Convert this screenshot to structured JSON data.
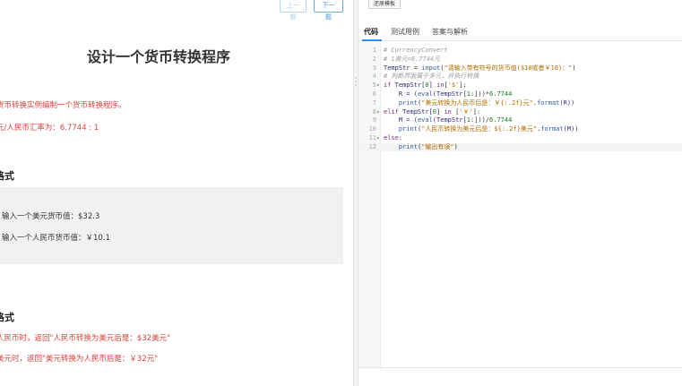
{
  "nav": {
    "prev_label": "上一题",
    "next_label": "下一题"
  },
  "problem": {
    "title": "设计一个货币转换程序",
    "desc_line1": "货币转换实例编制一个货币转换程序。",
    "desc_line2": "元/人民币汇率为：6.7744 : 1",
    "input_heading": "格式",
    "input_sample_1": "输入一个美元货币值：$32.3",
    "input_sample_2": "输入一个人民币货币值：￥10.1",
    "output_heading": "格式",
    "output_line1": "人民币时，返回\"人民币转换为美元后是：$32美元\"",
    "output_line2": "美元时，返回\"美元转换为人民币后是：￥32元\""
  },
  "editor_panel": {
    "restore_label": "还原模板",
    "tabs": [
      "代码",
      "测试用例",
      "答案与解析"
    ],
    "active_tab": "代码",
    "active_line": 12,
    "code_lines": [
      {
        "n": "1",
        "fold": "",
        "parts": [
          {
            "t": "# CurrencyConvert",
            "c": "c-com"
          }
        ]
      },
      {
        "n": "2",
        "fold": "",
        "parts": [
          {
            "t": "# 1美元=6.7744元",
            "c": "c-com"
          }
        ]
      },
      {
        "n": "3",
        "fold": "",
        "parts": [
          {
            "t": "TempStr",
            "c": "c-var"
          },
          {
            "t": " = ",
            "c": "c-p"
          },
          {
            "t": "input",
            "c": "c-fn"
          },
          {
            "t": "(",
            "c": "c-p"
          },
          {
            "t": "\"请输入带有符号的货币值($10或者￥10)：\"",
            "c": "c-str"
          },
          {
            "t": ")",
            "c": "c-p"
          }
        ]
      },
      {
        "n": "4",
        "fold": "",
        "parts": [
          {
            "t": "# 判断界面属于多元，并执行转换",
            "c": "c-com"
          }
        ]
      },
      {
        "n": "5",
        "fold": "▾",
        "parts": [
          {
            "t": "if",
            "c": "c-kw"
          },
          {
            "t": " TempStr[",
            "c": "c-var"
          },
          {
            "t": "0",
            "c": "c-num"
          },
          {
            "t": "] ",
            "c": "c-var"
          },
          {
            "t": "in",
            "c": "c-kw"
          },
          {
            "t": "[",
            "c": "c-p"
          },
          {
            "t": "'$'",
            "c": "c-str"
          },
          {
            "t": "]:",
            "c": "c-p"
          }
        ]
      },
      {
        "n": "6",
        "fold": "",
        "parts": [
          {
            "t": "    R = (",
            "c": "c-var"
          },
          {
            "t": "eval",
            "c": "c-fn"
          },
          {
            "t": "(TempStr[",
            "c": "c-var"
          },
          {
            "t": "1",
            "c": "c-num"
          },
          {
            "t": ":]))*",
            "c": "c-p"
          },
          {
            "t": "6.7744",
            "c": "c-num"
          }
        ]
      },
      {
        "n": "7",
        "fold": "",
        "parts": [
          {
            "t": "    ",
            "c": "c-p"
          },
          {
            "t": "print",
            "c": "c-fn"
          },
          {
            "t": "(",
            "c": "c-p"
          },
          {
            "t": "\"美元转换为人民币后是：￥{:.2f}元\"",
            "c": "c-str"
          },
          {
            "t": ".",
            "c": "c-p"
          },
          {
            "t": "format",
            "c": "c-fn"
          },
          {
            "t": "(R))",
            "c": "c-var"
          }
        ]
      },
      {
        "n": "8",
        "fold": "▾",
        "parts": [
          {
            "t": "elif",
            "c": "c-kw"
          },
          {
            "t": " TempStr[",
            "c": "c-var"
          },
          {
            "t": "0",
            "c": "c-num"
          },
          {
            "t": "] ",
            "c": "c-var"
          },
          {
            "t": "in",
            "c": "c-kw"
          },
          {
            "t": " [",
            "c": "c-p"
          },
          {
            "t": "'￥'",
            "c": "c-str"
          },
          {
            "t": "]:",
            "c": "c-p"
          }
        ]
      },
      {
        "n": "9",
        "fold": "",
        "parts": [
          {
            "t": "    M = (",
            "c": "c-var"
          },
          {
            "t": "eval",
            "c": "c-fn"
          },
          {
            "t": "(TempStr[",
            "c": "c-var"
          },
          {
            "t": "1",
            "c": "c-num"
          },
          {
            "t": ":]))/",
            "c": "c-p"
          },
          {
            "t": "6.7744",
            "c": "c-num"
          }
        ]
      },
      {
        "n": "10",
        "fold": "",
        "parts": [
          {
            "t": "    ",
            "c": "c-p"
          },
          {
            "t": "print",
            "c": "c-fn"
          },
          {
            "t": "(",
            "c": "c-p"
          },
          {
            "t": "\"人民币转换为美元后是：${:.2f}美元\"",
            "c": "c-str"
          },
          {
            "t": ".",
            "c": "c-p"
          },
          {
            "t": "format",
            "c": "c-fn"
          },
          {
            "t": "(M))",
            "c": "c-var"
          }
        ]
      },
      {
        "n": "11",
        "fold": "▾",
        "parts": [
          {
            "t": "else",
            "c": "c-kw"
          },
          {
            "t": ":",
            "c": "c-p"
          }
        ]
      },
      {
        "n": "12",
        "fold": "",
        "parts": [
          {
            "t": "    ",
            "c": "c-p"
          },
          {
            "t": "print",
            "c": "c-fn"
          },
          {
            "t": "(",
            "c": "c-p"
          },
          {
            "t": "\"输出有误\"",
            "c": "c-str"
          },
          {
            "t": ")",
            "c": "c-p"
          }
        ]
      }
    ]
  }
}
